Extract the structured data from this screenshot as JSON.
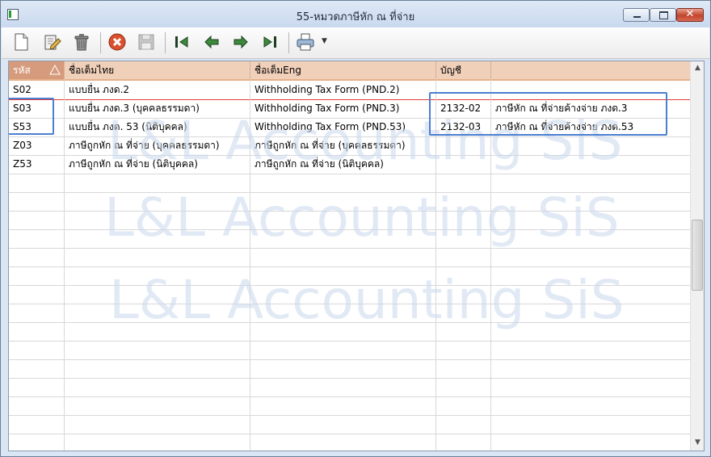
{
  "window": {
    "title": "55-หมวดภาษีหัก ณ ที่จ่าย"
  },
  "toolbar": {
    "buttons": [
      {
        "name": "new-document-icon"
      },
      {
        "name": "edit-icon"
      },
      {
        "name": "trash-icon"
      },
      {
        "name": "cancel-icon"
      },
      {
        "name": "save-icon"
      },
      {
        "name": "first-record-icon"
      },
      {
        "name": "previous-record-icon"
      },
      {
        "name": "next-record-icon"
      },
      {
        "name": "last-record-icon"
      },
      {
        "name": "printer-icon"
      }
    ]
  },
  "grid": {
    "columns": [
      "รหัส",
      "ชื่อเต็มไทย",
      "ชื่อเต็มEng",
      "บัญชี",
      ""
    ],
    "rows": [
      [
        "S02",
        "แบบยื่น ภงด.2",
        "Withholding Tax Form (PND.2)",
        "",
        ""
      ],
      [
        "S03",
        "แบบยื่น ภงด.3 (บุคคลธรรมดา)",
        "Withholding Tax  Form (PND.3)",
        "2132-02",
        "ภาษีหัก ณ ที่จ่ายค้างจ่าย ภงด.3"
      ],
      [
        "S53",
        "แบบยื่น ภงด. 53 (นิติบุคคล)",
        "Withholding Tax Form (PND.53)",
        "2132-03",
        "ภาษีหัก ณ ที่จ่ายค้างจ่าย ภงด.53"
      ],
      [
        "Z03",
        "ภาษีถูกหัก ณ ที่จ่าย (บุคคลธรรมดา)",
        "ภาษีถูกหัก ณ ที่จ่าย (บุคคลธรรมดา)",
        "",
        ""
      ],
      [
        "Z53",
        "ภาษีถูกหัก ณ ที่จ่าย (นิติบุคคล)",
        "ภาษีถูกหัก ณ ที่จ่าย (นิติบุคคล)",
        "",
        ""
      ]
    ],
    "watermark": "L&L Accounting SiS"
  },
  "colors": {
    "header_bg": "#f1d0ba",
    "sorted_header_bg": "#d69b7c",
    "highlight_box": "#4b7fd1"
  }
}
